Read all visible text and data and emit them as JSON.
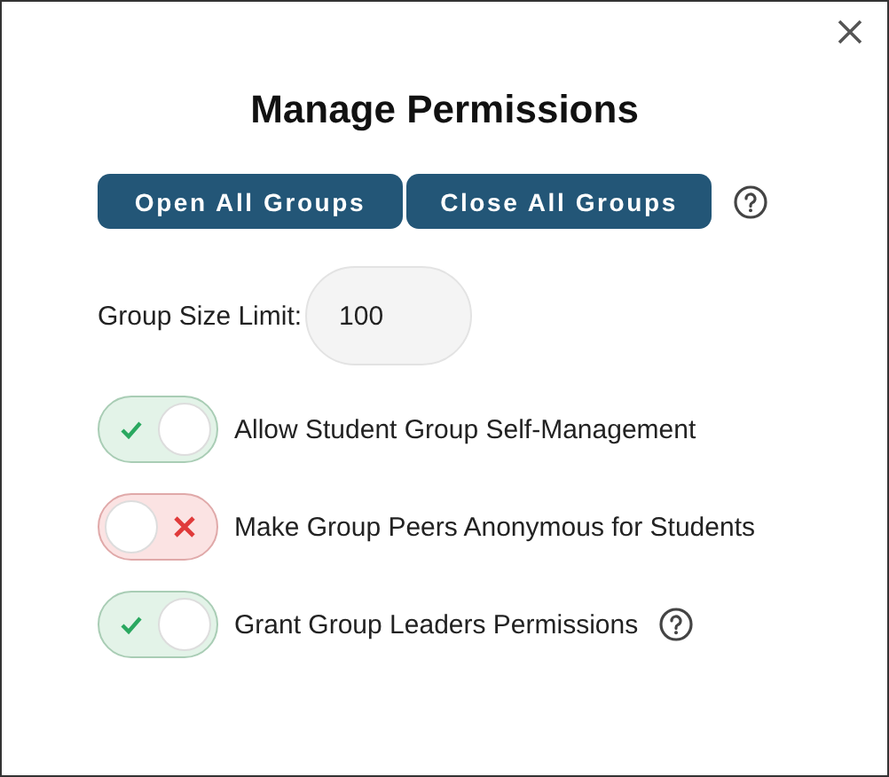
{
  "dialog": {
    "title": "Manage Permissions",
    "buttons": [
      "Open All Groups",
      "Close All Groups"
    ],
    "buttons_help": true,
    "size_limit": {
      "label": "Group Size Limit:",
      "value": "100"
    },
    "toggles": [
      {
        "label": "Allow Student Group Self-Management",
        "on": true,
        "help": false
      },
      {
        "label": "Make Group Peers Anonymous for Students",
        "on": false,
        "help": false
      },
      {
        "label": "Grant Group Leaders Permissions",
        "on": true,
        "help": true
      }
    ]
  }
}
